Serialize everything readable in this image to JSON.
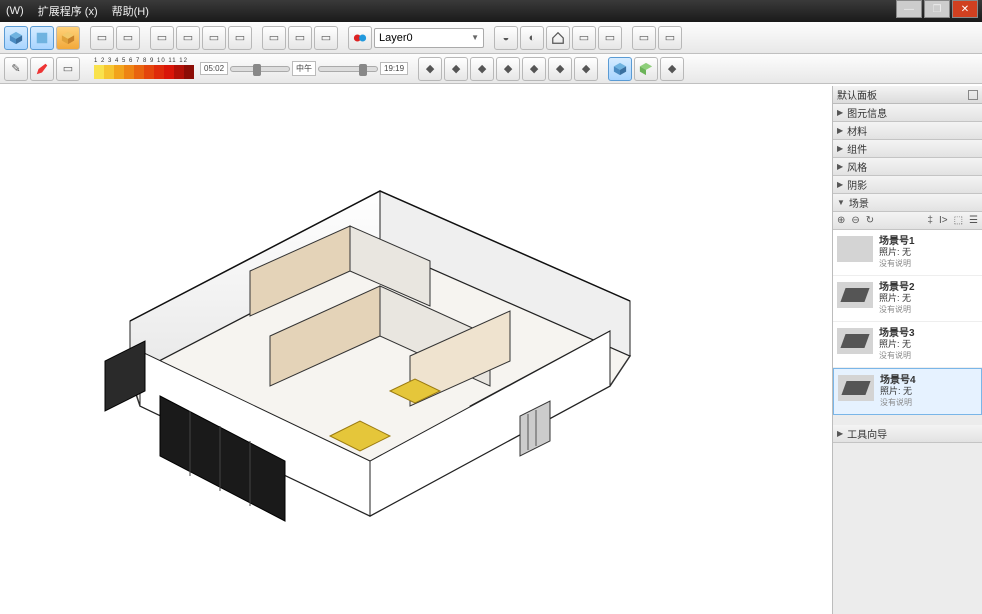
{
  "menubar": {
    "items": [
      "(W)",
      "扩展程序 (x)",
      "帮助(H)"
    ]
  },
  "layer": {
    "selected": "Layer0"
  },
  "timeline": {
    "numbers": "1 2 3 4 5 6 7 8 9 10 11 12",
    "t1": "05:02",
    "t2": "中午",
    "t3": "19:19"
  },
  "sidepanel": {
    "header": "默认面板",
    "sections": [
      "图元信息",
      "材料",
      "组件",
      "风格",
      "阴影",
      "场景"
    ],
    "toolbar": {
      "left": [
        "⊕",
        "⊖",
        "↻"
      ],
      "right": [
        "‡",
        "I>",
        "⬚",
        "☰"
      ]
    },
    "scenes": [
      {
        "name": "场景号1",
        "photo": "照片: 无",
        "note": "没有说明",
        "thumb": "light"
      },
      {
        "name": "场景号2",
        "photo": "照片: 无",
        "note": "没有说明",
        "thumb": "dark"
      },
      {
        "name": "场景号3",
        "photo": "照片: 无",
        "note": "没有说明",
        "thumb": "dark"
      },
      {
        "name": "场景号4",
        "photo": "照片: 无",
        "note": "没有说明",
        "thumb": "dark",
        "selected": true
      }
    ],
    "bottom_section": "工具向导"
  },
  "palette_colors": [
    "#f9e24d",
    "#f6c531",
    "#f2a41c",
    "#ee8413",
    "#e9640f",
    "#e4450c",
    "#df2a0a",
    "#d91508",
    "#b21007",
    "#8c0c05"
  ]
}
